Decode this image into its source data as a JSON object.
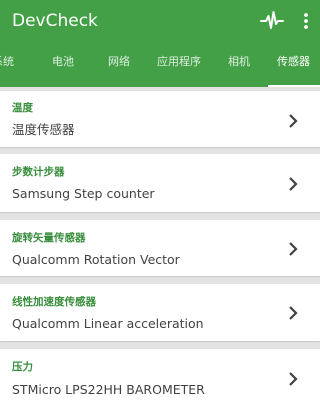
{
  "app": {
    "title": "DevCheck"
  },
  "toolbar": {
    "icons": [
      "pulse-icon",
      "more-vert-icon"
    ]
  },
  "tabs": [
    {
      "label": "系统",
      "active": false
    },
    {
      "label": "电池",
      "active": false
    },
    {
      "label": "网络",
      "active": false
    },
    {
      "label": "应用程序",
      "active": false
    },
    {
      "label": "相机",
      "active": false
    },
    {
      "label": "传感器",
      "active": true
    }
  ],
  "sensors": [
    {
      "title": "温度",
      "value": "温度传感器"
    },
    {
      "title": "步数计步器",
      "value": "Samsung Step counter"
    },
    {
      "title": "旋转矢量传感器",
      "value": "Qualcomm Rotation Vector"
    },
    {
      "title": "线性加速度传感器",
      "value": "Qualcomm Linear acceleration"
    },
    {
      "title": "压力",
      "value": "STMicro LPS22HH BAROMETER"
    }
  ],
  "colors": {
    "primary": "#43a047",
    "accent_text": "#388e3c",
    "background": "#e3e3e3"
  }
}
